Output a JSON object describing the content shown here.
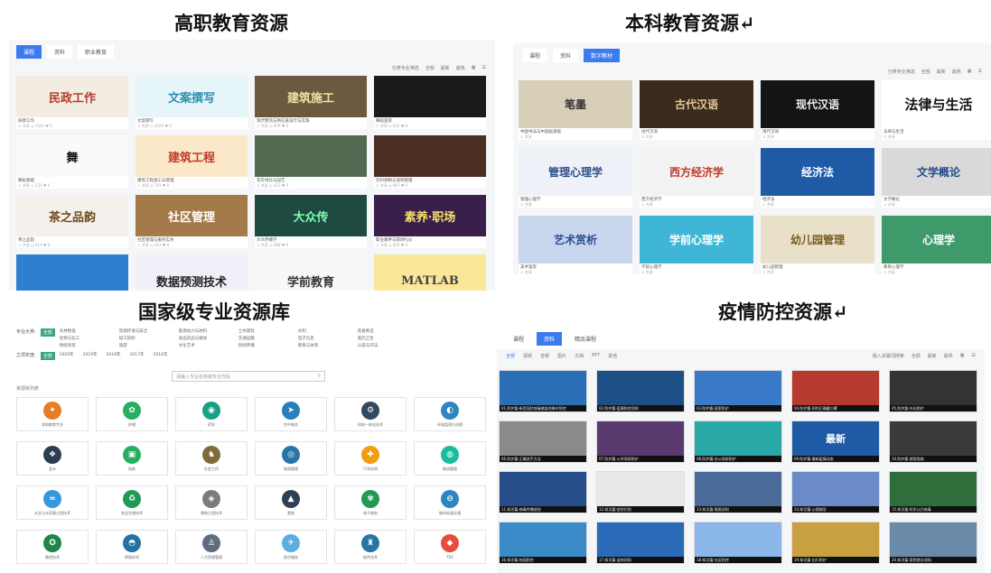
{
  "titles": {
    "q1": "高职教育资源",
    "q2": "本科教育资源↵",
    "q3": "国家级专业资源库",
    "q4": "疫情防控资源↵"
  },
  "vocational": {
    "tabs": [
      "课程",
      "资料",
      "职业教育"
    ],
    "toolbar": [
      "分类专业筛选",
      "全部",
      "最新",
      "最热",
      "▦",
      "☰"
    ],
    "cards": [
      {
        "thumb": "民政工作",
        "cap": "民政工作",
        "meta": "♙ 共享 ◎ 1543 ♥ 0",
        "bg": "#f3ece2",
        "fg": "#b23a2e"
      },
      {
        "thumb": "文案撰写",
        "cap": "文案撰写",
        "meta": "♙ 共享 ◎ 1022 ♥ 0",
        "bg": "#e6f6f8",
        "fg": "#2a8fb0"
      },
      {
        "thumb": "建筑施工",
        "cap": "现代物流与供应链设计与实践",
        "meta": "♙ 共享 ◎ 876 ♥ 0",
        "bg": "#6b5a40",
        "fg": "#f4e3a0"
      },
      {
        "thumb": "",
        "cap": "舞蹈鉴赏",
        "meta": "♙ 共享 ◎ 655 ♥ 0",
        "bg": "#1a1a1a",
        "fg": "#fff"
      },
      {
        "thumb": "舞",
        "cap": "舞蹈基础",
        "meta": "♙ 共享 ◎ 532 ♥ 0",
        "bg": "#fafafa",
        "fg": "#111"
      },
      {
        "thumb": "建筑工程",
        "cap": "建筑工程施工与管理",
        "meta": "♙ 共享 ◎ 781 ♥ 0",
        "bg": "#fbe8c8",
        "fg": "#c0392b"
      },
      {
        "thumb": "",
        "cap": "花卉绿化与园艺",
        "meta": "♙ 共享 ◎ 412 ♥ 0",
        "bg": "#536b52",
        "fg": "#fff"
      },
      {
        "thumb": "",
        "cap": "饮料调制与酒吧管理",
        "meta": "♙ 共享 ◎ 967 ♥ 0",
        "bg": "#4a2f22",
        "fg": "#fff"
      },
      {
        "thumb": "茶之品韵",
        "cap": "茶之品韵",
        "meta": "♙ 共享 ◎ 614 ♥ 0",
        "bg": "#f4f1ec",
        "fg": "#6e4a1e"
      },
      {
        "thumb": "社区管理",
        "cap": "社区管理与服务实务",
        "meta": "♙ 共享 ◎ 393 ♥ 0",
        "bg": "#a47a48",
        "fg": "#fff"
      },
      {
        "thumb": "大众传",
        "cap": "大众传播学",
        "meta": "♙ 共享 ◎ 488 ♥ 0",
        "bg": "#1f4a42",
        "fg": "#7dffb0"
      },
      {
        "thumb": "素养·职场",
        "cap": "职业素养与职场礼仪",
        "meta": "♙ 共享 ◎ 859 ♥ 0",
        "bg": "#3a1f4d",
        "fg": "#f4e06a"
      },
      {
        "thumb": "",
        "cap": "",
        "meta": "",
        "bg": "#2f7fd0",
        "fg": "#fff"
      },
      {
        "thumb": "数据预测技术",
        "cap": "",
        "meta": "",
        "bg": "#f0f0f8",
        "fg": "#222"
      },
      {
        "thumb": "学前教育",
        "cap": "",
        "meta": "",
        "bg": "#f8f8f8",
        "fg": "#333"
      },
      {
        "thumb": "MATLAB",
        "cap": "",
        "meta": "",
        "bg": "#fbe79a",
        "fg": "#444"
      }
    ]
  },
  "undergrad": {
    "tabs": [
      "课程",
      "资料",
      "数字教材"
    ],
    "toolbar": [
      "分类专业筛选",
      "全部",
      "最新",
      "最热",
      "▦",
      "☰"
    ],
    "cards": [
      {
        "thumb": "笔墨",
        "cap": "中国书法与中国画基础",
        "meta": "♙ 共享",
        "bg": "#d8cfb8",
        "fg": "#333"
      },
      {
        "thumb": "古代汉语",
        "cap": "古代汉语",
        "meta": "♙ 共享",
        "bg": "#3b2a1e",
        "fg": "#e8c99a"
      },
      {
        "thumb": "现代汉语",
        "cap": "现代汉语",
        "meta": "♙ 共享",
        "bg": "#141414",
        "fg": "#eee"
      },
      {
        "thumb": "法律与生活",
        "cap": "法律与生活",
        "meta": "♙ 共享",
        "bg": "#ffffff",
        "fg": "#111"
      },
      {
        "thumb": "管理心理学",
        "cap": "管理心理学",
        "meta": "♙ 共享",
        "bg": "#eef2f8",
        "fg": "#2b4f8a"
      },
      {
        "thumb": "西方经济学",
        "cap": "西方经济学",
        "meta": "♙ 共享",
        "bg": "#f2f2f2",
        "fg": "#c0392b"
      },
      {
        "thumb": "经济法",
        "cap": "经济法",
        "meta": "♙ 共享",
        "bg": "#1f5aa6",
        "fg": "#fff"
      },
      {
        "thumb": "文学概论",
        "cap": "文学概论",
        "meta": "♙ 共享",
        "bg": "#d9d9d9",
        "fg": "#1f4b8a"
      },
      {
        "thumb": "艺术赏析",
        "cap": "美术鉴赏",
        "meta": "♙ 共享",
        "bg": "#c8d6ee",
        "fg": "#2a4f8f"
      },
      {
        "thumb": "学前心理学",
        "cap": "学前心理学",
        "meta": "♙ 共享",
        "bg": "#3fb6d6",
        "fg": "#fff"
      },
      {
        "thumb": "幼儿园管理",
        "cap": "幼儿园管理",
        "meta": "♙ 共享",
        "bg": "#e8e0c8",
        "fg": "#7a5a20"
      },
      {
        "thumb": "心理学",
        "cap": "教育心理学",
        "meta": "♙ 共享",
        "bg": "#3e9a6a",
        "fg": "#fff"
      }
    ]
  },
  "national": {
    "filter1_label": "专业大类:",
    "filter1_badge": "全部",
    "filter1_opts": [
      "农林牧渔",
      "资源环境与安全",
      "能源动力与材料",
      "土木建筑",
      "水利",
      "装备制造",
      "生物与化工",
      "轻工纺织",
      "食品药品与粮食",
      "交通运输",
      "电子信息",
      "医药卫生",
      "财经商贸",
      "旅游",
      "文化艺术",
      "新闻传播",
      "教育与体育",
      "公安与司法"
    ],
    "filter2_label": "立项年度:",
    "filter2_badge": "全部",
    "filter2_opts": [
      "2020年",
      "2019年",
      "2018年",
      "2017年",
      "2016年"
    ],
    "search_placeholder": "请输入专业名称或专业代码",
    "section": "资源库列表",
    "logos": [
      {
        "ic": "✦",
        "nm": "学前教育专业",
        "c": "#e67e22"
      },
      {
        "ic": "✿",
        "nm": "护理",
        "c": "#27ae60"
      },
      {
        "ic": "◉",
        "nm": "药学",
        "c": "#16a085"
      },
      {
        "ic": "➤",
        "nm": "空中乘务",
        "c": "#2980b9"
      },
      {
        "ic": "⚙",
        "nm": "机电一体化技术",
        "c": "#34495e"
      },
      {
        "ic": "◐",
        "nm": "环境监测与治理",
        "c": "#2e86c1"
      },
      {
        "ic": "❖",
        "nm": "会计",
        "c": "#2c3e50"
      },
      {
        "ic": "▣",
        "nm": "园林",
        "c": "#27ae60"
      },
      {
        "ic": "♞",
        "nm": "社会工作",
        "c": "#7f6a3a"
      },
      {
        "ic": "◎",
        "nm": "旅游管理",
        "c": "#2874a6"
      },
      {
        "ic": "✚",
        "nm": "汽车检测",
        "c": "#f39c12"
      },
      {
        "ic": "◍",
        "nm": "物流管理",
        "c": "#1abc9c"
      },
      {
        "ic": "≈",
        "nm": "水文与水资源工程技术",
        "c": "#3498db"
      },
      {
        "ic": "♻",
        "nm": "农业生物技术",
        "c": "#229954"
      },
      {
        "ic": "◈",
        "nm": "建筑工程技术",
        "c": "#7b7d7d"
      },
      {
        "ic": "▲",
        "nm": "畜牧",
        "c": "#2e4053"
      },
      {
        "ic": "✾",
        "nm": "电子商务",
        "c": "#229954"
      },
      {
        "ic": "⊖",
        "nm": "城市轨道交通",
        "c": "#2e86c1"
      },
      {
        "ic": "✪",
        "nm": "数控技术",
        "c": "#1e8449"
      },
      {
        "ic": "◓",
        "nm": "焊接技术",
        "c": "#2471a3"
      },
      {
        "ic": "♙",
        "nm": "人力资源管理",
        "c": "#5d6d7e"
      },
      {
        "ic": "✈",
        "nm": "航空服务",
        "c": "#5dade2"
      },
      {
        "ic": "♜",
        "nm": "软件技术",
        "c": "#2874a6"
      },
      {
        "ic": "◆",
        "nm": "TDF",
        "c": "#e74c3c"
      }
    ]
  },
  "epidemic": {
    "tabs": [
      "课程",
      "资料",
      "精品课程"
    ],
    "filters": [
      "全部",
      "视频",
      "音频",
      "图片",
      "文档",
      "PPT",
      "其他"
    ],
    "toolbar": [
      "输入关键词搜索",
      "全部",
      "最新",
      "最热",
      "▦",
      "☰"
    ],
    "videos": [
      {
        "t": "",
        "cap": "01.防护篇-新型冠状病毒感染的肺炎防控",
        "bg": "#2a6fb6"
      },
      {
        "t": "",
        "cap": "02.防护篇-疫情防控须知",
        "bg": "#1c4f86"
      },
      {
        "t": "",
        "cap": "03.防护篇-居家防护",
        "bg": "#3a78c8"
      },
      {
        "t": "",
        "cap": "04.防护篇-如何正确戴口罩",
        "bg": "#b63a2e"
      },
      {
        "t": "",
        "cap": "05.防护篇-外出防护",
        "bg": "#333"
      },
      {
        "t": "",
        "cap": "06.防护篇-正确洗手方法",
        "bg": "#8a8a8a"
      },
      {
        "t": "",
        "cap": "07.防护篇-公共场所防护",
        "bg": "#5a3a6e"
      },
      {
        "t": "",
        "cap": "08.防护篇-办公场所防护",
        "bg": "#2aa8a8"
      },
      {
        "t": "最新",
        "cap": "09.防护篇-最新疫情动态",
        "bg": "#1f5aa6"
      },
      {
        "t": "",
        "cap": "10.防护篇-就医指南",
        "bg": "#3a3a3a"
      },
      {
        "t": "",
        "cap": "11.知识篇-病毒传播途径",
        "bg": "#264e8a"
      },
      {
        "t": "",
        "cap": "12.知识篇-症状识别",
        "bg": "#e8e8e8"
      },
      {
        "t": "",
        "cap": "13.知识篇-隔离须知",
        "bg": "#4a6a9a"
      },
      {
        "t": "",
        "cap": "14.知识篇-心理疏导",
        "bg": "#6a8ac8"
      },
      {
        "t": "",
        "cap": "15.知识篇-科学认识病毒",
        "bg": "#2f6e3a"
      },
      {
        "t": "",
        "cap": "16.知识篇-校园防控",
        "bg": "#3a8ac8"
      },
      {
        "t": "",
        "cap": "17.知识篇-返岗须知",
        "bg": "#2a6ab6"
      },
      {
        "t": "",
        "cap": "18.知识篇-社区防控",
        "bg": "#8ab6e8"
      },
      {
        "t": "",
        "cap": "19.知识篇-出行防护",
        "bg": "#c8a040"
      },
      {
        "t": "",
        "cap": "20.知识篇-医院就诊须知",
        "bg": "#6a8aa8"
      }
    ]
  }
}
